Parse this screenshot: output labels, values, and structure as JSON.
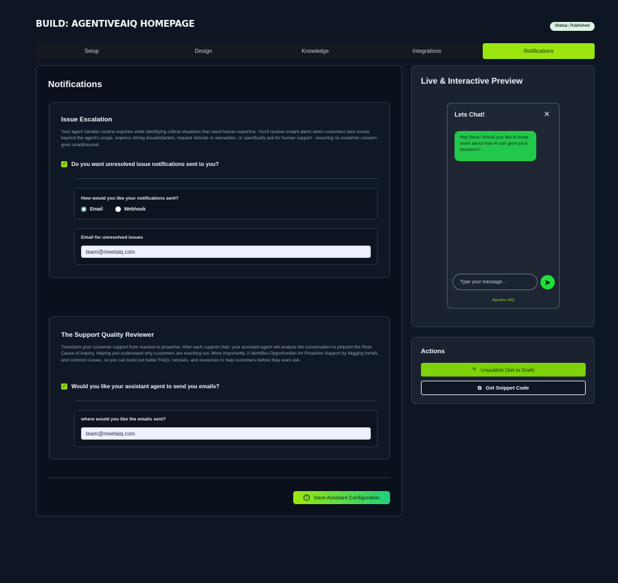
{
  "header": {
    "title": "BUILD: AGENTIVEAIQ HOMEPAGE",
    "status": "Status: Published"
  },
  "tabs": [
    {
      "label": "Setup"
    },
    {
      "label": "Design"
    },
    {
      "label": "Knowledge"
    },
    {
      "label": "Integrations"
    },
    {
      "label": "Notifications",
      "active": true
    }
  ],
  "notifications": {
    "title": "Notifications",
    "escalation": {
      "title": "Issue Escalation",
      "description": "Your agent handles routine inquiries while identifying critical situations that need human expertise. You'll receive instant alerts when customers face issues beyond the agent's scope, express strong dissatisfaction, request refunds or warranties, or specifically ask for human support - ensuring no customer concern goes unaddressed.",
      "checkbox_label": "Do you want unresolved issue notifications sent to you?",
      "checked": true,
      "method_label": "How would you like your notifications sent?",
      "methods": [
        "Email",
        "Webhook"
      ],
      "selected_method": "Email",
      "email_label": "Email for unresolved issues",
      "email_value": "team@meetaiq.com"
    },
    "reviewer": {
      "title": "The Support Quality Reviewer",
      "description": "Transform your customer support from reactive to proactive. After each support chat, your assistant agent will analyze the conversation to pinpoint the Root Cause of Inquiry, helping you understand why customers are reaching out. More importantly, it identifies Opportunities for Proactive Support by flagging trends and common issues, so you can build out better FAQs, tutorials, and resources to help customers before they even ask.",
      "checkbox_label": "Would you like your assistant agent to send you emails?",
      "checked": true,
      "email_label": "where would you like the emails sent?",
      "email_value": "team@meetaiq.com"
    },
    "save_label": "Save Assistant Configuration"
  },
  "preview": {
    "title": "Live & Interactive Preview",
    "chat_title": "Lets Chat!",
    "close_glyph": "✕",
    "bubble_text": "Hey there! Would you like to know more about how AI can grow your business?",
    "input_placeholder": "Type your message...",
    "brand": "Agentive AIQ"
  },
  "actions": {
    "title": "Actions",
    "unpublish_label": "Unpublish (Set to Draft)",
    "snippet_label": "Get Snippet Code"
  },
  "colors": {
    "accent": "#9be60f",
    "chat_green": "#21c84a",
    "background": "#0e1624"
  }
}
